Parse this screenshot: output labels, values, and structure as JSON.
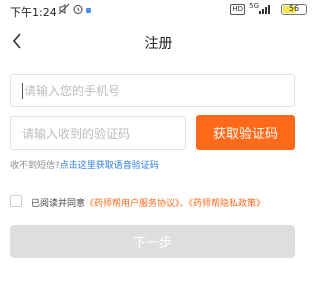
{
  "status_bar": {
    "time": "下午1:24",
    "network_badge": "HD",
    "network_type": "5G",
    "battery_level": "56"
  },
  "nav": {
    "back_icon": "chevron-left-icon",
    "title": "注册"
  },
  "form": {
    "phone_placeholder": "请输入您的手机号",
    "code_placeholder": "请输入收到的验证码",
    "get_code_label": "获取验证码",
    "voice_prompt": "收不到短信?",
    "voice_link": "点击这里获取语音验证码"
  },
  "agreement": {
    "checked": false,
    "prefix": "已阅读并同意",
    "user_agreement": "《药师帮用户服务协议》",
    "separator": "、",
    "privacy_policy": "《药师帮隐私政策》"
  },
  "next_label": "下一步",
  "colors": {
    "accent": "#ff6a1a",
    "link": "#2f7de1",
    "disabled_button": "#dedede"
  }
}
